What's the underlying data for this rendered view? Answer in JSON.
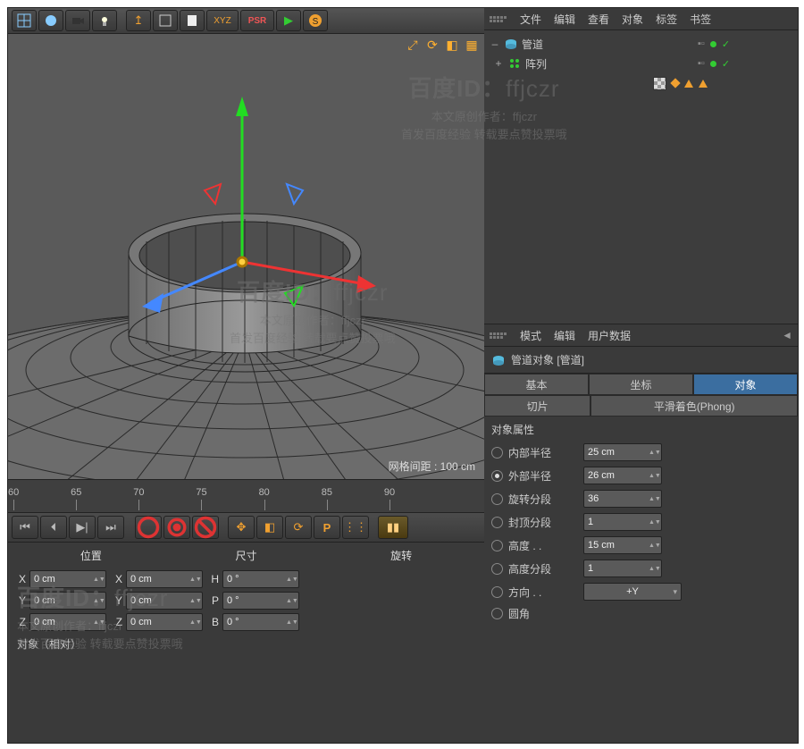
{
  "toolbar": {
    "icons": [
      "grid",
      "sphere",
      "camera",
      "light",
      "human",
      "arrow-up",
      "view",
      "page",
      "axis-toggle",
      "psr",
      "play",
      "maxon"
    ]
  },
  "viewport": {
    "grid_label": "网格间距 : 100 cm"
  },
  "timeline": {
    "frames": [
      60,
      65,
      70,
      75,
      80,
      85,
      90
    ]
  },
  "playback": {
    "buttons": [
      "go-start",
      "prev-key",
      "play-rev",
      "play",
      "next-key",
      "go-end",
      "rec-circle",
      "rec-key",
      "auto-key",
      "move-tool",
      "scale-tool",
      "loop",
      "p-button",
      "grid-snap",
      "film"
    ]
  },
  "coord": {
    "headers": [
      "位置",
      "尺寸",
      "旋转"
    ],
    "rows": [
      {
        "axis": "X",
        "pos": "0 cm",
        "size": "0 cm",
        "rot": "0 °"
      },
      {
        "axis": "Y",
        "pos": "0 cm",
        "size": "0 cm",
        "rot": "0 °"
      },
      {
        "axis": "Z",
        "pos": "0 cm",
        "size": "0 cm",
        "rot": "0 °"
      }
    ],
    "footer": "对象（相对）"
  },
  "object_manager": {
    "menus": [
      "文件",
      "编辑",
      "查看",
      "对象",
      "标签",
      "书签"
    ],
    "rows": [
      {
        "toggle": "–",
        "icon": "tube",
        "name": "管道",
        "tagset": "basic"
      },
      {
        "toggle": "+",
        "icon": "array",
        "name": "阵列",
        "tagset": "basic",
        "indent": true
      },
      {
        "toggle": "",
        "icon": "",
        "name": "",
        "tagset": "extra",
        "indent2": true
      }
    ]
  },
  "attribute_manager": {
    "menus": [
      "模式",
      "编辑",
      "用户数据"
    ],
    "title": "管道对象 [管道]",
    "tabs": [
      "基本",
      "坐标",
      "对象",
      "切片",
      "平滑着色(Phong)"
    ],
    "active_tab": 2,
    "section": "对象属性",
    "attrs": [
      {
        "label": "内部半径",
        "value": "25 cm",
        "radio": true
      },
      {
        "label": "外部半径",
        "value": "26 cm",
        "radio": true,
        "radio_on": true
      },
      {
        "label": "旋转分段",
        "value": "36",
        "radio": true
      },
      {
        "label": "封顶分段",
        "value": "1",
        "radio": true
      },
      {
        "label": "高度 . .",
        "value": "15 cm",
        "radio": true
      },
      {
        "label": "高度分段",
        "value": "1",
        "radio": true
      },
      {
        "label": "方向 . .",
        "value": "+Y",
        "radio": true,
        "select": true
      }
    ],
    "last_label": "圆角"
  },
  "watermark": {
    "title_prefix": "百度ID：",
    "title_user": "ffjczr",
    "line1": "本文原创作者：ffjczr",
    "line2": "首发百度经验  转载要点赞投票哦"
  }
}
